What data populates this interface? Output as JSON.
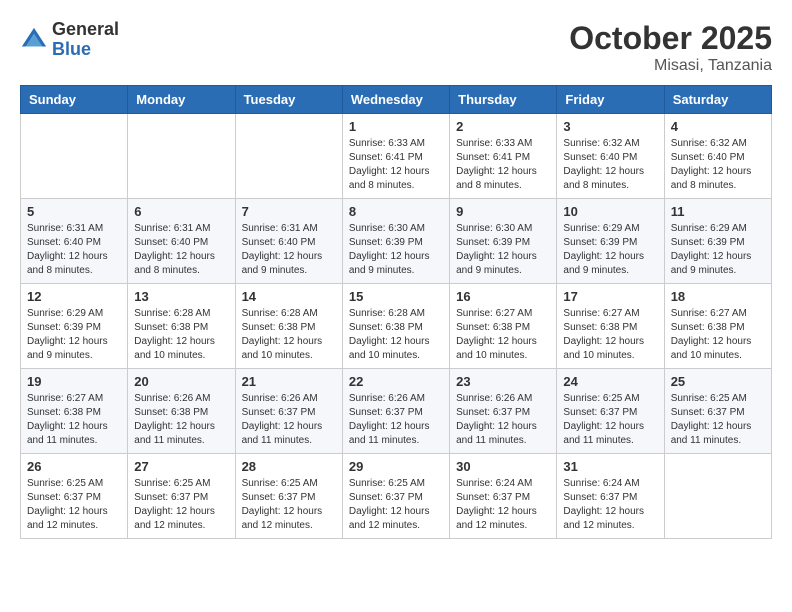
{
  "header": {
    "logo_general": "General",
    "logo_blue": "Blue",
    "month": "October 2025",
    "location": "Misasi, Tanzania"
  },
  "weekdays": [
    "Sunday",
    "Monday",
    "Tuesday",
    "Wednesday",
    "Thursday",
    "Friday",
    "Saturday"
  ],
  "weeks": [
    [
      {
        "day": "",
        "info": ""
      },
      {
        "day": "",
        "info": ""
      },
      {
        "day": "",
        "info": ""
      },
      {
        "day": "1",
        "info": "Sunrise: 6:33 AM\nSunset: 6:41 PM\nDaylight: 12 hours and 8 minutes."
      },
      {
        "day": "2",
        "info": "Sunrise: 6:33 AM\nSunset: 6:41 PM\nDaylight: 12 hours and 8 minutes."
      },
      {
        "day": "3",
        "info": "Sunrise: 6:32 AM\nSunset: 6:40 PM\nDaylight: 12 hours and 8 minutes."
      },
      {
        "day": "4",
        "info": "Sunrise: 6:32 AM\nSunset: 6:40 PM\nDaylight: 12 hours and 8 minutes."
      }
    ],
    [
      {
        "day": "5",
        "info": "Sunrise: 6:31 AM\nSunset: 6:40 PM\nDaylight: 12 hours and 8 minutes."
      },
      {
        "day": "6",
        "info": "Sunrise: 6:31 AM\nSunset: 6:40 PM\nDaylight: 12 hours and 8 minutes."
      },
      {
        "day": "7",
        "info": "Sunrise: 6:31 AM\nSunset: 6:40 PM\nDaylight: 12 hours and 9 minutes."
      },
      {
        "day": "8",
        "info": "Sunrise: 6:30 AM\nSunset: 6:39 PM\nDaylight: 12 hours and 9 minutes."
      },
      {
        "day": "9",
        "info": "Sunrise: 6:30 AM\nSunset: 6:39 PM\nDaylight: 12 hours and 9 minutes."
      },
      {
        "day": "10",
        "info": "Sunrise: 6:29 AM\nSunset: 6:39 PM\nDaylight: 12 hours and 9 minutes."
      },
      {
        "day": "11",
        "info": "Sunrise: 6:29 AM\nSunset: 6:39 PM\nDaylight: 12 hours and 9 minutes."
      }
    ],
    [
      {
        "day": "12",
        "info": "Sunrise: 6:29 AM\nSunset: 6:39 PM\nDaylight: 12 hours and 9 minutes."
      },
      {
        "day": "13",
        "info": "Sunrise: 6:28 AM\nSunset: 6:38 PM\nDaylight: 12 hours and 10 minutes."
      },
      {
        "day": "14",
        "info": "Sunrise: 6:28 AM\nSunset: 6:38 PM\nDaylight: 12 hours and 10 minutes."
      },
      {
        "day": "15",
        "info": "Sunrise: 6:28 AM\nSunset: 6:38 PM\nDaylight: 12 hours and 10 minutes."
      },
      {
        "day": "16",
        "info": "Sunrise: 6:27 AM\nSunset: 6:38 PM\nDaylight: 12 hours and 10 minutes."
      },
      {
        "day": "17",
        "info": "Sunrise: 6:27 AM\nSunset: 6:38 PM\nDaylight: 12 hours and 10 minutes."
      },
      {
        "day": "18",
        "info": "Sunrise: 6:27 AM\nSunset: 6:38 PM\nDaylight: 12 hours and 10 minutes."
      }
    ],
    [
      {
        "day": "19",
        "info": "Sunrise: 6:27 AM\nSunset: 6:38 PM\nDaylight: 12 hours and 11 minutes."
      },
      {
        "day": "20",
        "info": "Sunrise: 6:26 AM\nSunset: 6:38 PM\nDaylight: 12 hours and 11 minutes."
      },
      {
        "day": "21",
        "info": "Sunrise: 6:26 AM\nSunset: 6:37 PM\nDaylight: 12 hours and 11 minutes."
      },
      {
        "day": "22",
        "info": "Sunrise: 6:26 AM\nSunset: 6:37 PM\nDaylight: 12 hours and 11 minutes."
      },
      {
        "day": "23",
        "info": "Sunrise: 6:26 AM\nSunset: 6:37 PM\nDaylight: 12 hours and 11 minutes."
      },
      {
        "day": "24",
        "info": "Sunrise: 6:25 AM\nSunset: 6:37 PM\nDaylight: 12 hours and 11 minutes."
      },
      {
        "day": "25",
        "info": "Sunrise: 6:25 AM\nSunset: 6:37 PM\nDaylight: 12 hours and 11 minutes."
      }
    ],
    [
      {
        "day": "26",
        "info": "Sunrise: 6:25 AM\nSunset: 6:37 PM\nDaylight: 12 hours and 12 minutes."
      },
      {
        "day": "27",
        "info": "Sunrise: 6:25 AM\nSunset: 6:37 PM\nDaylight: 12 hours and 12 minutes."
      },
      {
        "day": "28",
        "info": "Sunrise: 6:25 AM\nSunset: 6:37 PM\nDaylight: 12 hours and 12 minutes."
      },
      {
        "day": "29",
        "info": "Sunrise: 6:25 AM\nSunset: 6:37 PM\nDaylight: 12 hours and 12 minutes."
      },
      {
        "day": "30",
        "info": "Sunrise: 6:24 AM\nSunset: 6:37 PM\nDaylight: 12 hours and 12 minutes."
      },
      {
        "day": "31",
        "info": "Sunrise: 6:24 AM\nSunset: 6:37 PM\nDaylight: 12 hours and 12 minutes."
      },
      {
        "day": "",
        "info": ""
      }
    ]
  ]
}
